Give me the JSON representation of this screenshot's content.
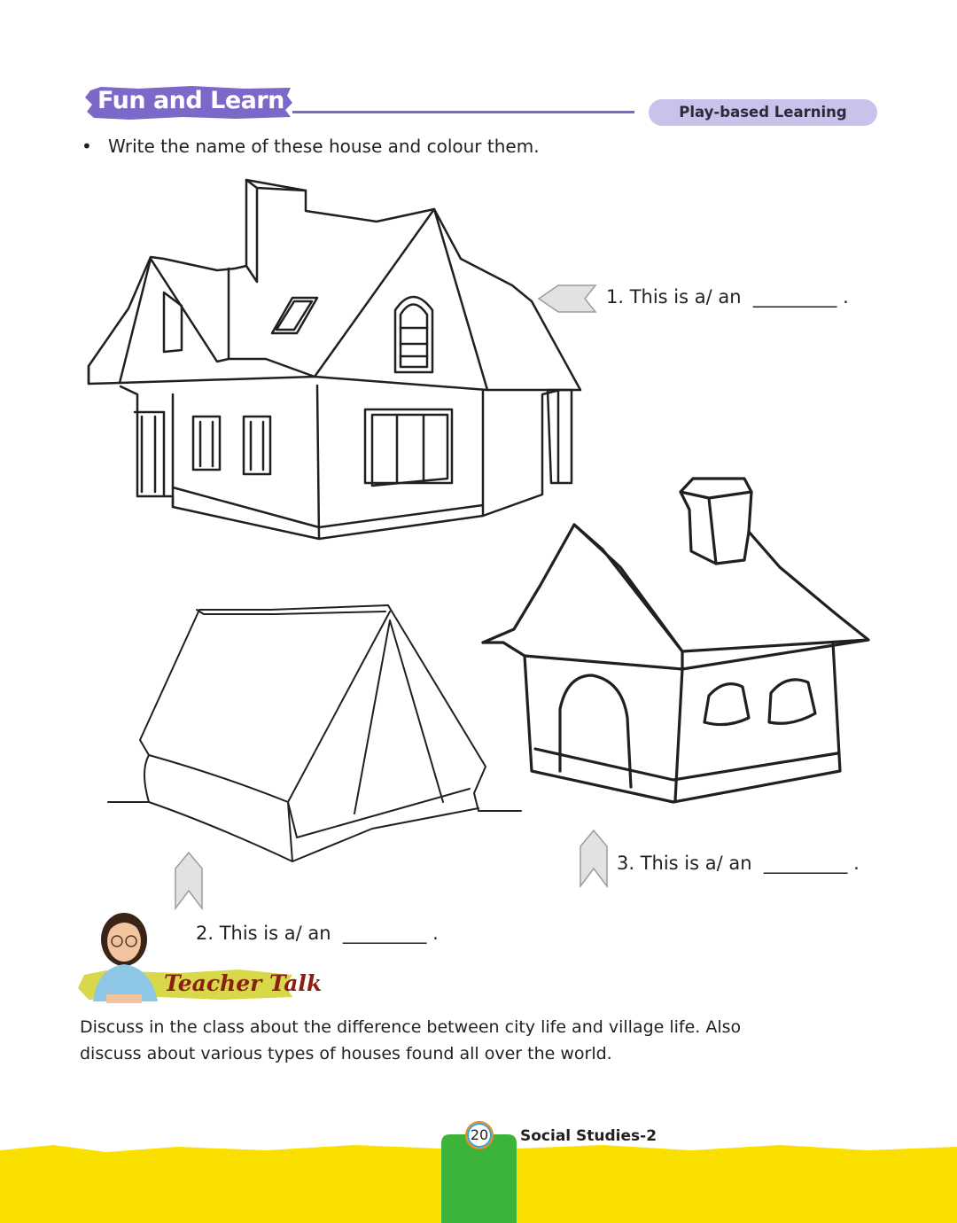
{
  "header": {
    "section_title": "Fun and Learn",
    "badge": "Play-based Learning",
    "accent_color": "#7b68c8",
    "badge_color": "#c9c2ea"
  },
  "instruction": {
    "bullet": "•",
    "text": "Write the name of these house and colour them."
  },
  "questions": [
    {
      "label": "1. This is a/ an  _________ ."
    },
    {
      "label": "2. This is a/ an  _________ ."
    },
    {
      "label": "3. This is a/ an  _________ ."
    }
  ],
  "teacher_talk": {
    "label": "Teacher Talk",
    "text": "Discuss in the class about the difference between city life and village life. Also discuss about various types of houses found all over the world."
  },
  "footer": {
    "page_number": "20",
    "book_title": "Social Studies-2",
    "band_color": "#f9e000",
    "tab_color": "#3cb43c"
  }
}
